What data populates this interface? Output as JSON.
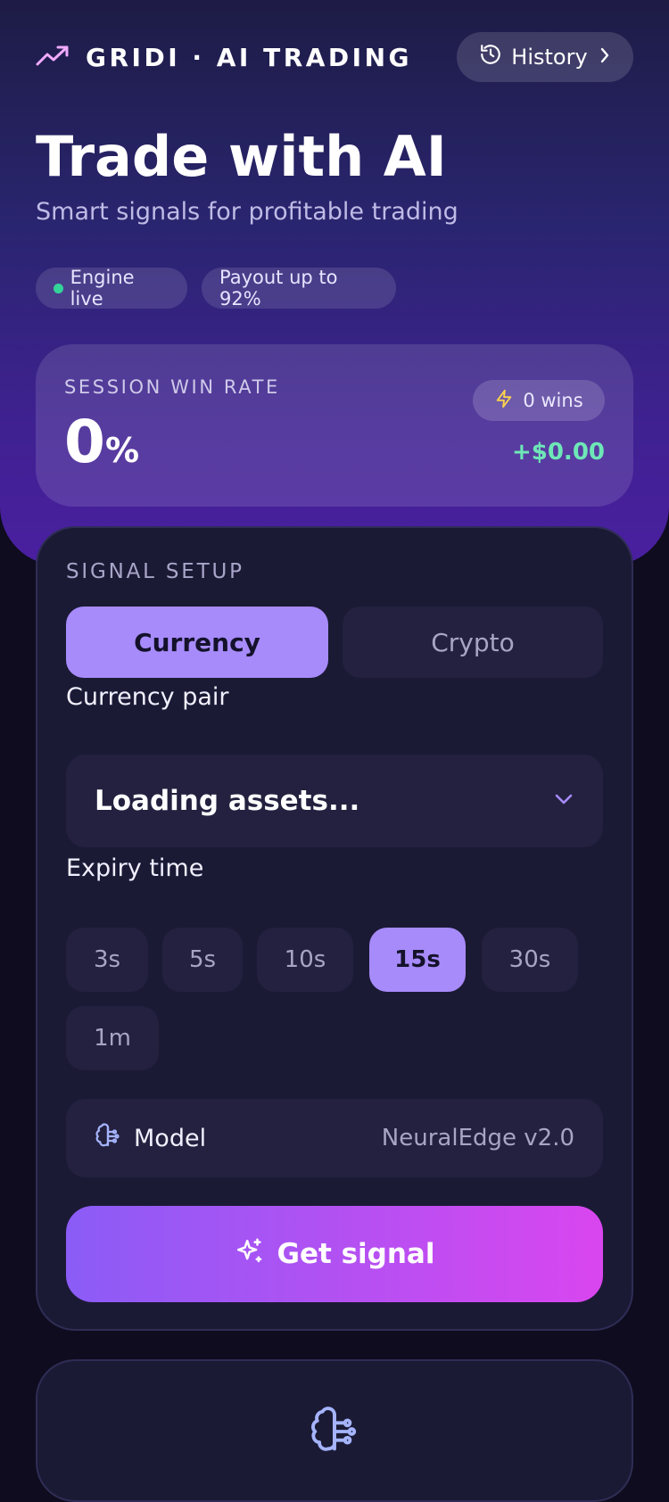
{
  "header": {
    "brand": "GRIDI · AI TRADING",
    "brand_icon": "trending-up-icon",
    "history_label": "History",
    "history_icon": "history-icon",
    "title": "Trade with AI",
    "subtitle": "Smart signals for profitable trading",
    "pills": [
      {
        "label": "Engine live",
        "status_color": "#34d399"
      },
      {
        "label": "Payout up to 92%"
      }
    ]
  },
  "stats": {
    "label": "SESSION WIN RATE",
    "win_rate_value": "0",
    "win_rate_unit": "%",
    "wins_label": "0 wins",
    "wins_icon": "lightning-icon",
    "profit": "+$0.00",
    "profit_color": "#6ee7b7"
  },
  "signal_setup": {
    "label": "SIGNAL SETUP",
    "tabs": [
      {
        "label": "Currency",
        "active": true
      },
      {
        "label": "Crypto",
        "active": false
      }
    ],
    "pair_label": "Currency pair",
    "pair_value": "Loading assets...",
    "expiry_label": "Expiry time",
    "expiry_options": [
      {
        "label": "3s",
        "active": false
      },
      {
        "label": "5s",
        "active": false
      },
      {
        "label": "10s",
        "active": false
      },
      {
        "label": "15s",
        "active": true
      },
      {
        "label": "30s",
        "active": false
      },
      {
        "label": "1m",
        "active": false
      }
    ],
    "model_label": "Model",
    "model_value": "NeuralEdge v2.0",
    "model_icon": "brain-icon",
    "cta_label": "Get signal",
    "cta_icon": "sparkle-icon"
  },
  "colors": {
    "accent": "#a78bfa",
    "cta_start": "#8b5cf6",
    "cta_end": "#d946ef",
    "background": "#0e0c1e",
    "card": "#1b1a35"
  }
}
